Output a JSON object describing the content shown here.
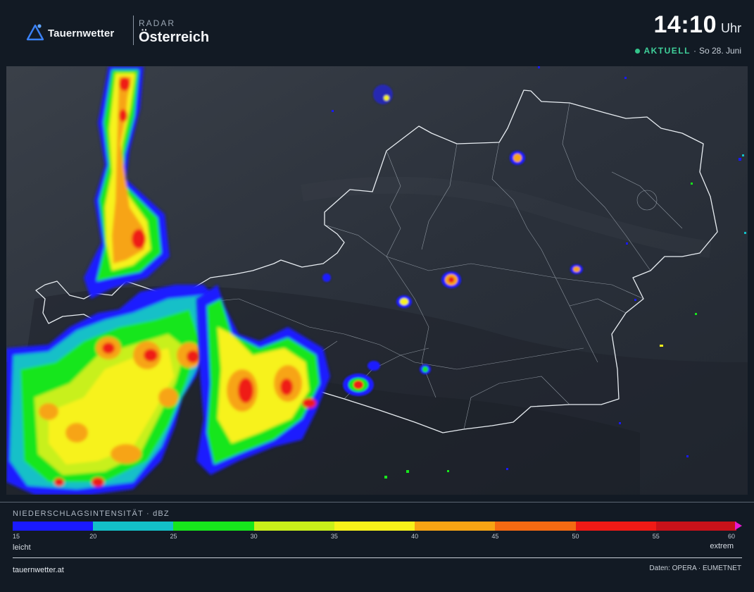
{
  "brand": {
    "name": "Tauernwetter",
    "logo_icon": "mountain-triangle-icon",
    "accent": "#3b82f6"
  },
  "section": {
    "kicker": "RADAR",
    "title": "Österreich"
  },
  "clock": {
    "time": "14:10",
    "unit": "Uhr"
  },
  "status": {
    "live_label": "AKTUELL",
    "separator": "·",
    "date": "So 28. Juni",
    "live_color": "#33c48a"
  },
  "legend": {
    "title": "NIEDERSCHLAGSINTENSITÄT · dBZ",
    "colors": [
      "#1a1aff",
      "#13c0c8",
      "#17e61c",
      "#c8f01a",
      "#f7f21a",
      "#f7a414",
      "#f46a12",
      "#ef1a16",
      "#c8121a"
    ],
    "ticks": [
      "15",
      "20",
      "25",
      "30",
      "35",
      "40",
      "45",
      "50",
      "55",
      "60"
    ],
    "low_label": "leicht",
    "high_label": "extrem",
    "arrow_color": "#e81ad0"
  },
  "footer": {
    "site": "tauernwetter.at",
    "source": "Daten: OPERA · EUMETNET"
  }
}
